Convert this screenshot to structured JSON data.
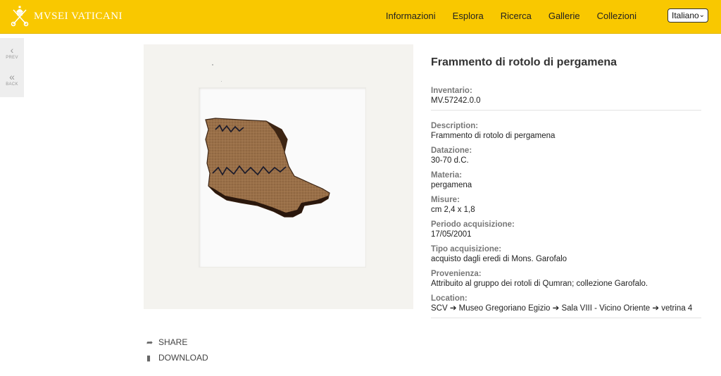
{
  "header": {
    "logo_text": "MVSEI VATICANI",
    "nav": [
      "Informazioni",
      "Esplora",
      "Ricerca",
      "Gallerie",
      "Collezioni"
    ],
    "language": "Italiano",
    "brand_color": "#f9c800"
  },
  "sidebar": {
    "prev_label": "PREV",
    "back_label": "BACK"
  },
  "artwork": {
    "title": "Frammento di rotolo di pergamena",
    "fields": [
      {
        "label": "Inventario:",
        "value": "MV.57242.0.0"
      },
      {
        "label": "Description:",
        "value": "Frammento di rotolo di pergamena"
      },
      {
        "label": "Datazione:",
        "value": "30-70 d.C."
      },
      {
        "label": "Materia:",
        "value": "pergamena"
      },
      {
        "label": "Misure:",
        "value": "cm 2,4 x 1,8"
      },
      {
        "label": "Periodo acquisizione:",
        "value": "17/05/2001"
      },
      {
        "label": "Tipo acquisizione:",
        "value": "acquisto dagli eredi di Mons. Garofalo"
      },
      {
        "label": "Provenienza:",
        "value": "Attribuito al gruppo dei rotoli di Qumran; collezione Garofalo."
      },
      {
        "label": "Location:",
        "value": "SCV ➔ Museo Gregoriano Egizio ➔ Sala VIII - Vicino Oriente ➔ vetrina 4"
      }
    ]
  },
  "actions": {
    "share_label": "SHARE",
    "download_label": "DOWNLOAD"
  }
}
